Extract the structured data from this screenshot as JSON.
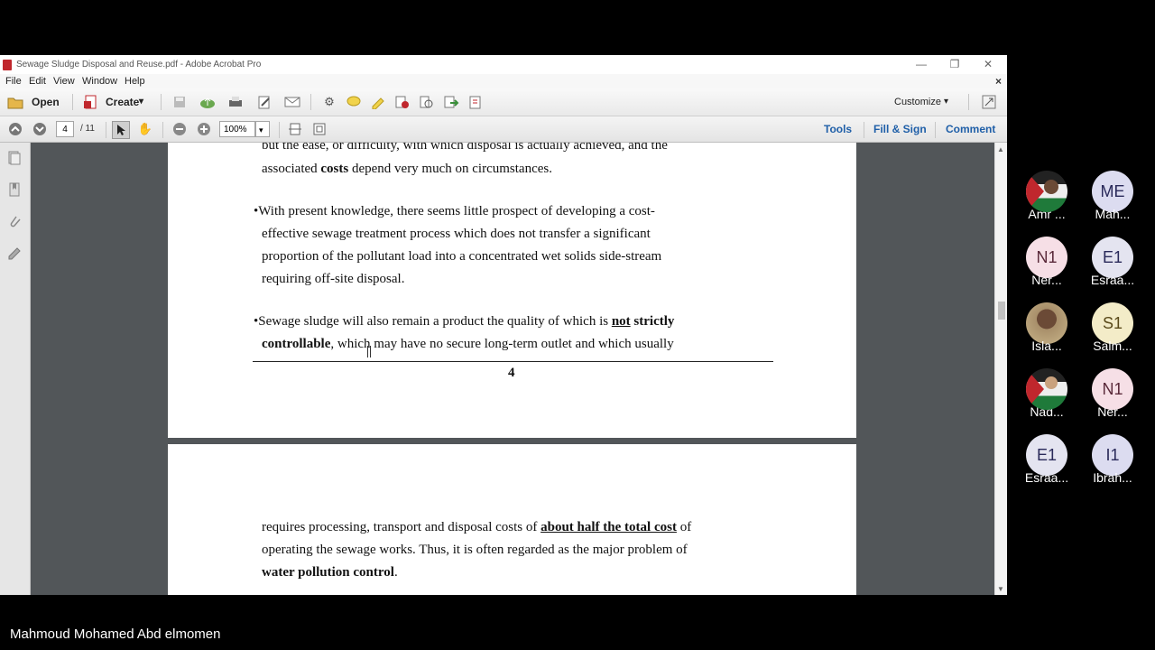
{
  "window": {
    "title": "Sewage Sludge Disposal and Reuse.pdf - Adobe Acrobat Pro",
    "minimize": "—",
    "restore": "❐",
    "close": "✕",
    "close_doc": "×"
  },
  "menu": [
    "File",
    "Edit",
    "View",
    "Window",
    "Help"
  ],
  "toolbar": {
    "open_label": "Open",
    "create_label": "Create",
    "create_caret": "▾",
    "customize_label": "Customize",
    "customize_caret": "▾"
  },
  "nav": {
    "current_page": "4",
    "page_total": "/ 11",
    "zoom": "100%",
    "zoom_caret": "▾",
    "tools_label": "Tools",
    "fill_sign_label": "Fill & Sign",
    "comment_label": "Comment"
  },
  "page1": {
    "line1": "but the ease, or difficulty, with which disposal is actually achieved, and the",
    "line2_pre": "associated ",
    "line2_bold": "costs",
    "line2_post": " depend very much on circumstances.",
    "b1_l1": "•With present knowledge, there seems little prospect of developing a cost-",
    "b1_l2": "effective sewage treatment process which does not transfer a significant",
    "b1_l3": "proportion of the pollutant load into a concentrated wet solids side-stream",
    "b1_l4": "requiring off-site disposal.",
    "b2_l1_pre": "•Sewage sludge will also remain a product the quality of which is ",
    "b2_l1_u": "not",
    "b2_l1_bold": " strictly",
    "b2_l2_bold": "controllable",
    "b2_l2_post": ", which may have no secure long-term outlet and which usually",
    "page_number": "4"
  },
  "page2": {
    "l1_pre": "requires processing, transport and disposal costs of ",
    "l1_u": "about half the total cost",
    "l1_post": " of",
    "l2": "operating the sewage works.  Thus, it is often regarded as the major problem of",
    "l3_bold": "water pollution control",
    "l3_post": "."
  },
  "participants": [
    {
      "initials": "",
      "name": "Amr ..."
    },
    {
      "initials": "ME",
      "name": "Mah..."
    },
    {
      "initials": "N1",
      "name": "Ner..."
    },
    {
      "initials": "E1",
      "name": "Esraa..."
    },
    {
      "initials": "",
      "name": "Isla..."
    },
    {
      "initials": "S1",
      "name": "Salm..."
    },
    {
      "initials": "",
      "name": "Nad..."
    },
    {
      "initials": "N1",
      "name": "Ner..."
    },
    {
      "initials": "E1",
      "name": "Esraa..."
    },
    {
      "initials": "I1",
      "name": "Ibrah..."
    }
  ],
  "speaker": "Mahmoud Mohamed Abd elmomen",
  "colors": {
    "accent": "#1f5fa8",
    "avatar_bg": "#dcdcf0"
  }
}
